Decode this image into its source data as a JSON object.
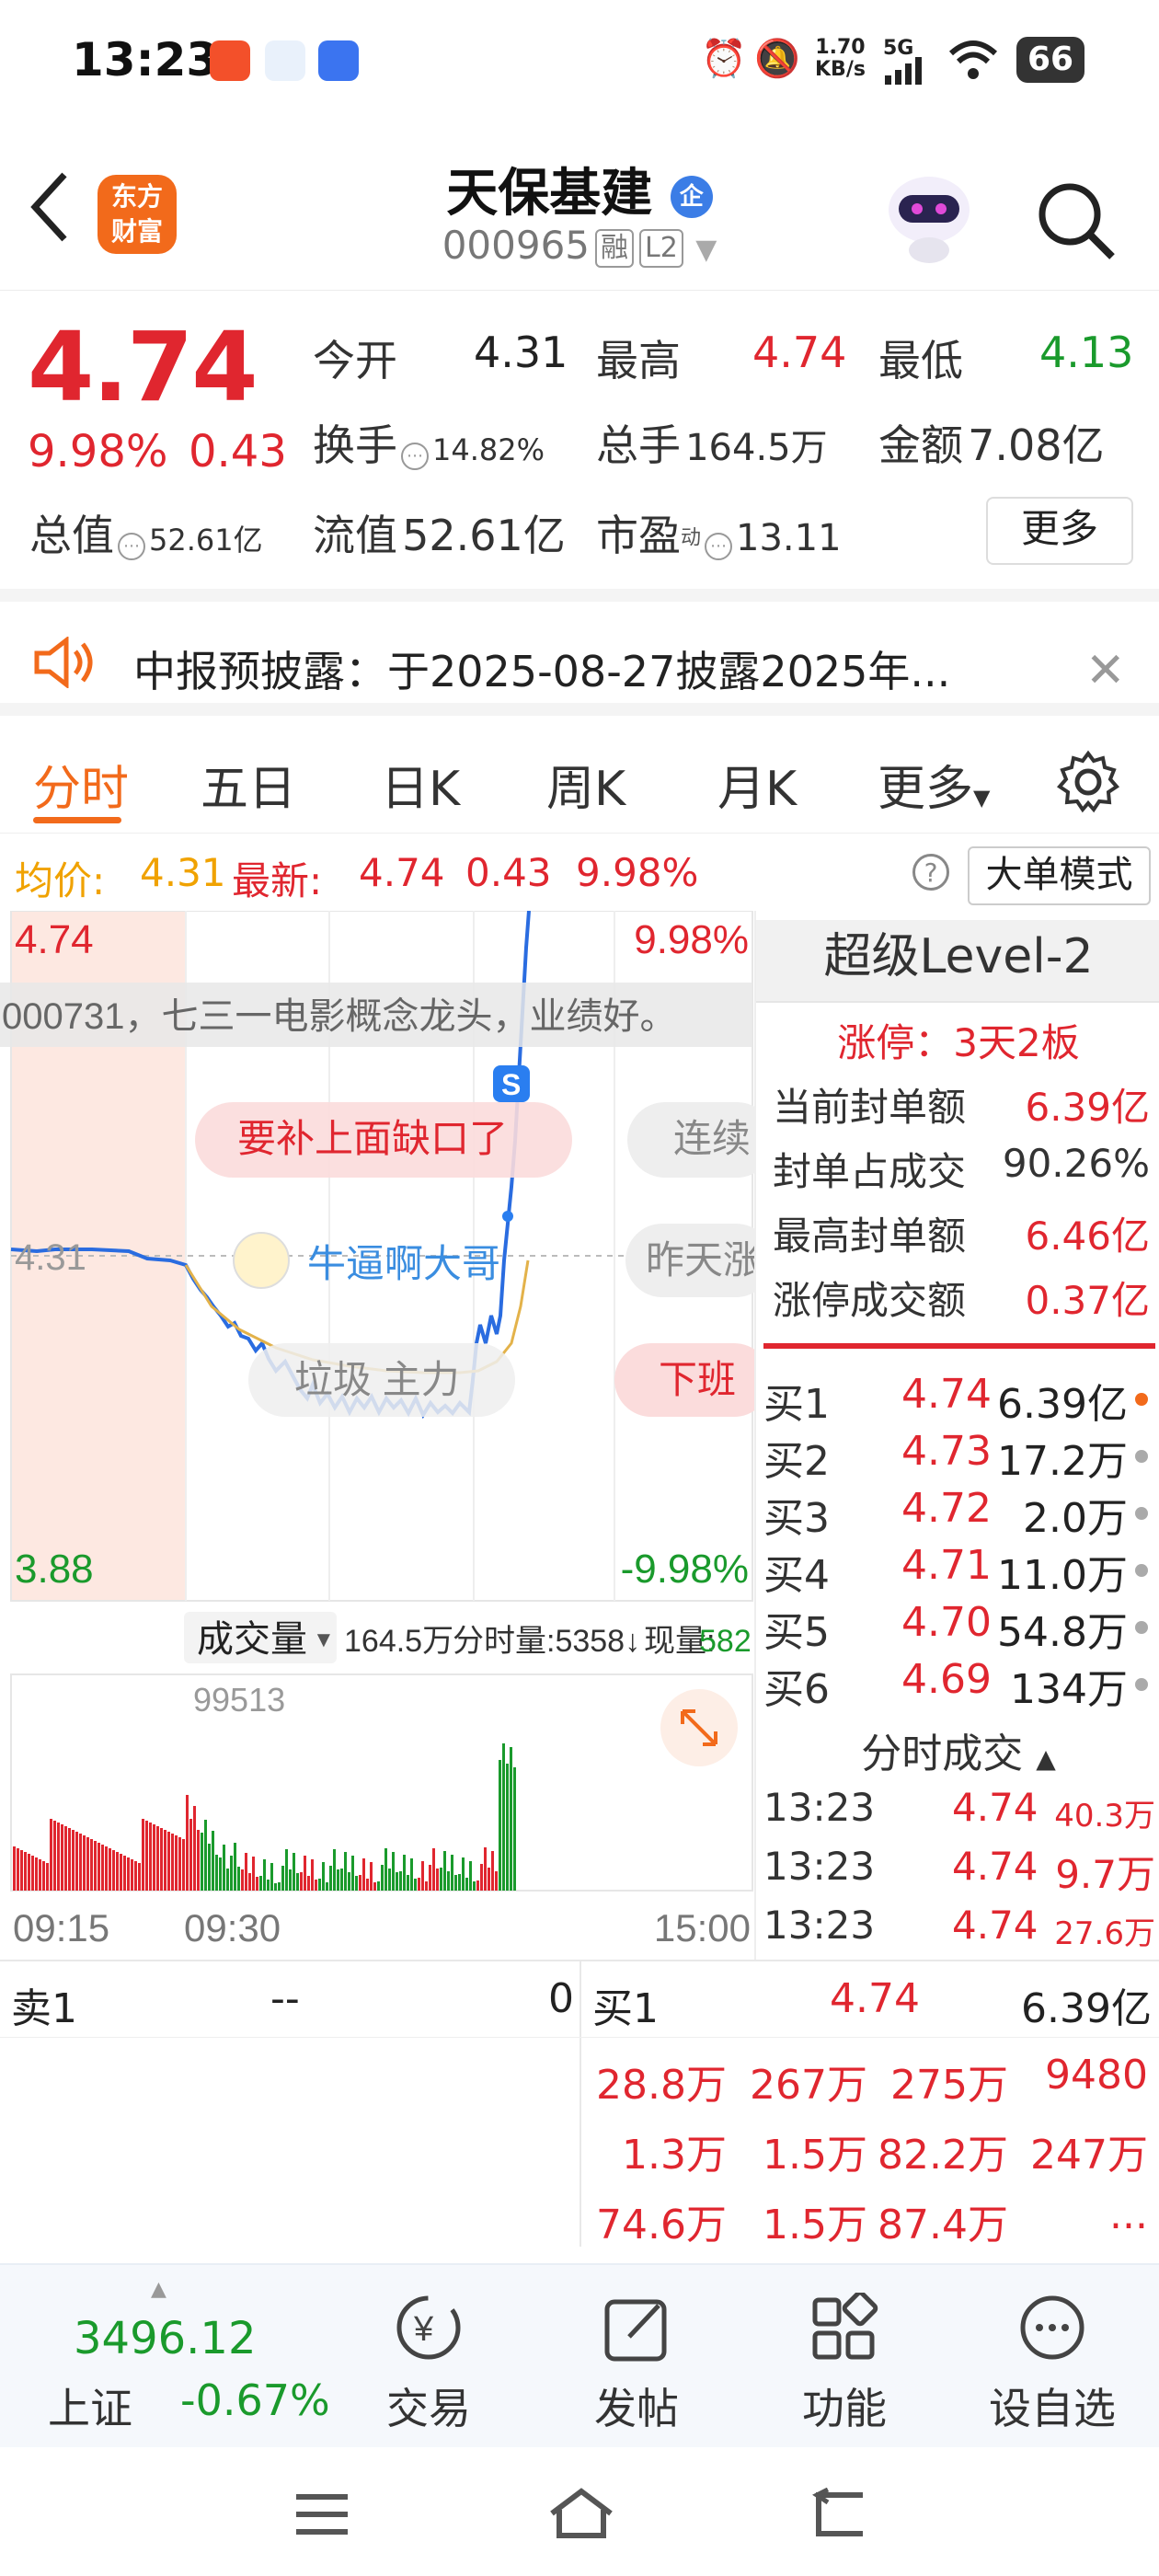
{
  "status_bar": {
    "time": "13:23",
    "net_speed_top": "1.70",
    "net_speed_unit": "KB/s",
    "signal": "5G",
    "battery": "66"
  },
  "header": {
    "brand_line1": "东方",
    "brand_line2": "财富",
    "stock_name": "天保基建",
    "name_badge": "企",
    "stock_code": "000965",
    "tag_margin": "融",
    "tag_level": "L2"
  },
  "quote": {
    "last_price": "4.74",
    "change_pct": "9.98%",
    "change_abs": "0.43",
    "open_label": "今开",
    "open_value": "4.31",
    "high_label": "最高",
    "high_value": "4.74",
    "low_label": "最低",
    "low_value": "4.13",
    "turnover_label": "换手",
    "turnover_value": "14.82%",
    "volume_label": "总手",
    "volume_value": "164.5万",
    "amount_label": "金额",
    "amount_value": "7.08亿",
    "mktcap_label": "总值",
    "mktcap_value": "52.61亿",
    "float_label": "流值",
    "float_value": "52.61亿",
    "pe_label": "市盈",
    "pe_sup": "动",
    "pe_value": "13.11",
    "more_button": "更多"
  },
  "notice": {
    "text": "中报预披露：于2025-08-27披露2025年..."
  },
  "tabs": [
    "分时",
    "五日",
    "日K",
    "周K",
    "月K",
    "更多"
  ],
  "info_line": {
    "avg_label": "均价:",
    "avg_value": "4.31",
    "latest_label": "最新:",
    "latest_value": "4.74",
    "latest_change": "0.43",
    "latest_pct": "9.98%",
    "help": "?",
    "bigorder_button": "大单模式"
  },
  "chart": {
    "top_price": "4.74",
    "top_pct": "9.98%",
    "mid_price": "4.31",
    "bottom_price": "3.88",
    "bottom_pct": "-9.98%",
    "danmaku_1": "000731，七三一电影概念龙头，业绩好。",
    "danmaku_2": "要补上面缺口了",
    "danmaku_3": "连续",
    "danmaku_4": "牛逼啊大哥",
    "danmaku_5": "昨天涨",
    "danmaku_6": "垃圾 主力",
    "danmaku_7": "下班",
    "s_marker": "S",
    "vol_label": "成交量",
    "vol_total": "164.5万",
    "vol_tick_label": "分时量:5358↓",
    "vol_now_label": "现量:",
    "vol_now_value": "582",
    "vol_max": "99513",
    "time_start": "09:15",
    "time_open": "09:30",
    "time_end": "15:00"
  },
  "level2": {
    "title": "超级Level-2",
    "limit_up": "涨停：3天2板",
    "rows": [
      {
        "label": "当前封单额",
        "value": "6.39亿"
      },
      {
        "label": "封单占成交",
        "value": "90.26%"
      },
      {
        "label": "最高封单额",
        "value": "6.46亿"
      },
      {
        "label": "涨停成交额",
        "value": "0.37亿"
      }
    ],
    "bids": [
      {
        "label": "买1",
        "price": "4.74",
        "vol": "6.39亿",
        "dot": "#f26a1b"
      },
      {
        "label": "买2",
        "price": "4.73",
        "vol": "17.2万",
        "dot": "#aaaaaa"
      },
      {
        "label": "买3",
        "price": "4.72",
        "vol": "2.0万",
        "dot": "#aaaaaa"
      },
      {
        "label": "买4",
        "price": "4.71",
        "vol": "11.0万",
        "dot": "#aaaaaa"
      },
      {
        "label": "买5",
        "price": "4.70",
        "vol": "54.8万",
        "dot": "#aaaaaa"
      },
      {
        "label": "买6",
        "price": "4.69",
        "vol": "134万",
        "dot": "#aaaaaa"
      }
    ],
    "ticks_title": "分时成交",
    "ticks": [
      {
        "time": "13:23",
        "price": "4.74",
        "vol": "40.3万"
      },
      {
        "time": "13:23",
        "price": "4.74",
        "vol": "9.7万"
      },
      {
        "time": "13:23",
        "price": "4.74",
        "vol": "27.6万"
      }
    ]
  },
  "orderbook": {
    "ask_label": "卖1",
    "ask_price": "--",
    "ask_vol": "0",
    "bid_label": "买1",
    "bid_price": "4.74",
    "bid_vol": "6.39亿",
    "queue": [
      [
        "28.8万",
        "267万",
        "275万",
        "9480"
      ],
      [
        "1.3万",
        "1.5万",
        "82.2万",
        "247万"
      ],
      [
        "74.6万",
        "1.5万",
        "87.4万",
        "..."
      ]
    ]
  },
  "bottom_nav": {
    "index_value": "3496.12",
    "index_name": "上证",
    "index_change": "-0.67%",
    "items": [
      "交易",
      "发帖",
      "功能",
      "设自选"
    ]
  }
}
